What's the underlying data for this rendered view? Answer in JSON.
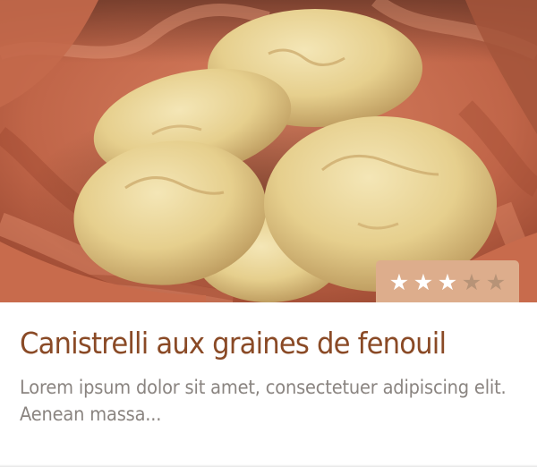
{
  "card": {
    "title": "Canistrelli aux graines de fenouil",
    "description": "Lorem ipsum dolor sit amet, consectetuer adipiscing elit. Aenean massa...",
    "rating": {
      "value": 3,
      "max": 5
    },
    "image": {
      "icon": "biscuits-in-basket-photo"
    }
  },
  "colors": {
    "title": "#8a4a26",
    "description": "#8a8480",
    "rating_background": "#ddad8c",
    "star_filled": "#ffffff",
    "star_empty": "#b79377"
  }
}
